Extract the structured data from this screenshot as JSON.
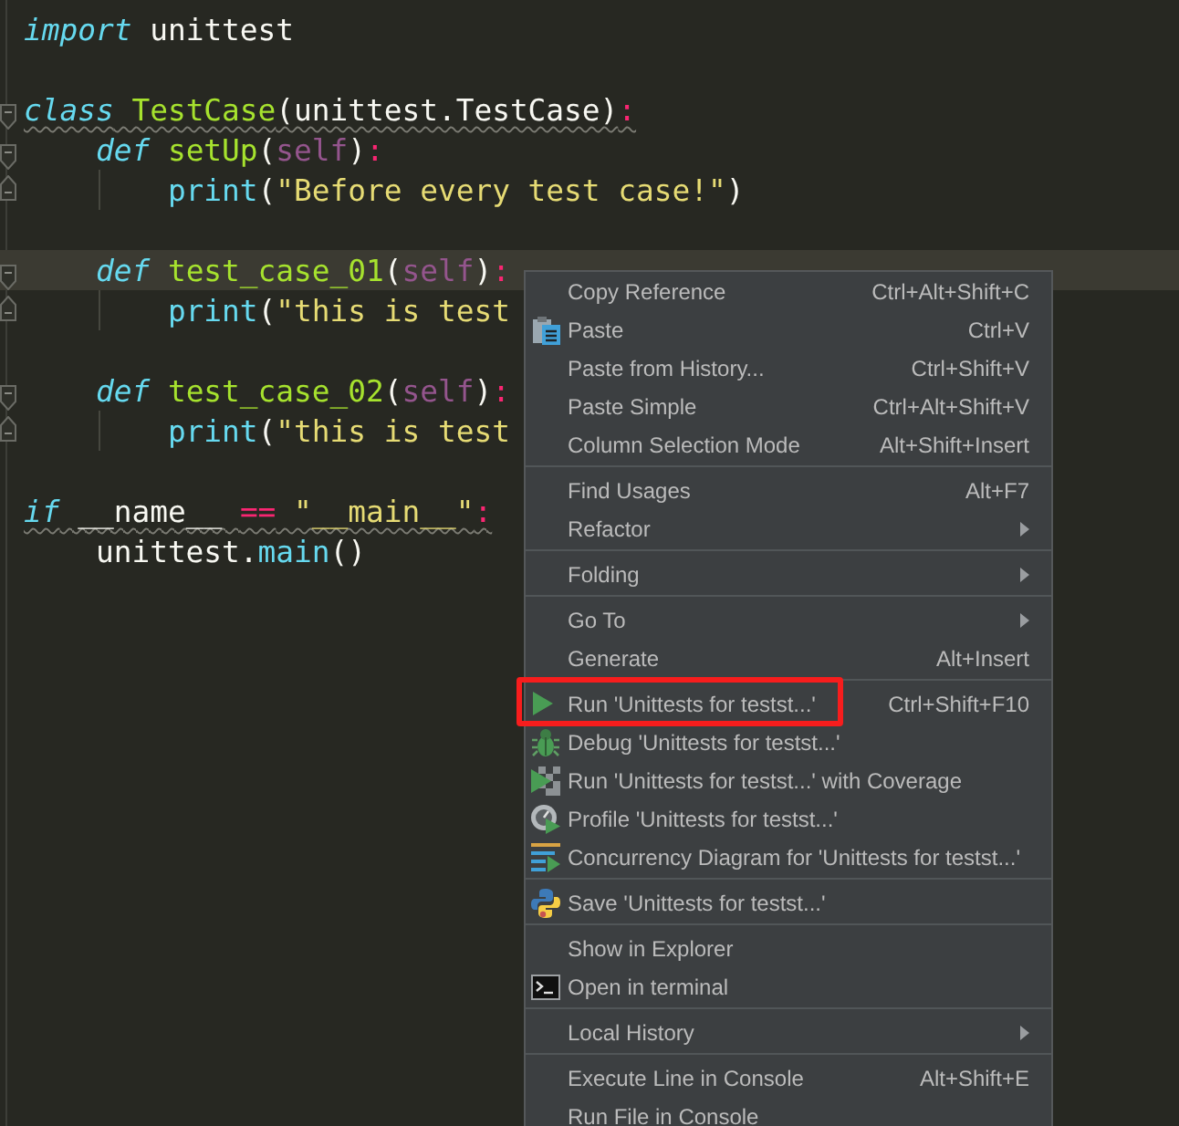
{
  "editor": {
    "lines": [
      {
        "kind": "code",
        "current": false,
        "warning": false,
        "fold_start": false,
        "fold_end": false,
        "tokens": [
          {
            "text": "import",
            "kind": "keyword"
          },
          {
            "text": " unittest",
            "kind": "plain"
          }
        ]
      },
      {
        "kind": "blank"
      },
      {
        "kind": "code",
        "current": false,
        "warning": true,
        "fold_start": true,
        "fold_end": false,
        "tokens": [
          {
            "text": "class",
            "kind": "keyword"
          },
          {
            "text": " TestCase",
            "kind": "name"
          },
          {
            "text": "(unittest.TestCase)",
            "kind": "plain"
          },
          {
            "text": ":",
            "kind": "punct"
          }
        ],
        "children": [
          {
            "kind": "code",
            "current": false,
            "warning": false,
            "fold_start": true,
            "fold_end": false,
            "tokens": [
              {
                "text": "def",
                "kind": "keyword"
              },
              {
                "text": " setUp",
                "kind": "name"
              },
              {
                "text": "(",
                "kind": "plain"
              },
              {
                "text": "self",
                "kind": "self"
              },
              {
                "text": ")",
                "kind": "plain"
              },
              {
                "text": ":",
                "kind": "punct"
              }
            ],
            "children": [
              {
                "kind": "code",
                "current": false,
                "warning": false,
                "fold_start": false,
                "fold_end": true,
                "tokens": [
                  {
                    "text": "print",
                    "kind": "builtin"
                  },
                  {
                    "text": "(",
                    "kind": "plain"
                  },
                  {
                    "text": "\"Before every test case!\"",
                    "kind": "string"
                  },
                  {
                    "text": ")",
                    "kind": "plain"
                  }
                ]
              }
            ]
          },
          {
            "kind": "blank"
          },
          {
            "kind": "code",
            "current": true,
            "warning": false,
            "fold_start": true,
            "fold_end": false,
            "tokens": [
              {
                "text": "def",
                "kind": "keyword"
              },
              {
                "text": " test_case_01",
                "kind": "name"
              },
              {
                "text": "(",
                "kind": "plain"
              },
              {
                "text": "self",
                "kind": "self"
              },
              {
                "text": ")",
                "kind": "plain"
              },
              {
                "text": ":",
                "kind": "punct"
              }
            ],
            "children": [
              {
                "kind": "code",
                "current": false,
                "warning": false,
                "fold_start": false,
                "fold_end": true,
                "tokens": [
                  {
                    "text": "print",
                    "kind": "builtin"
                  },
                  {
                    "text": "(",
                    "kind": "plain"
                  },
                  {
                    "text": "\"this is test",
                    "kind": "string"
                  }
                ]
              }
            ]
          },
          {
            "kind": "blank"
          },
          {
            "kind": "code",
            "current": false,
            "warning": false,
            "fold_start": true,
            "fold_end": false,
            "tokens": [
              {
                "text": "def",
                "kind": "keyword"
              },
              {
                "text": " test_case_02",
                "kind": "name"
              },
              {
                "text": "(",
                "kind": "plain"
              },
              {
                "text": "self",
                "kind": "self"
              },
              {
                "text": ")",
                "kind": "plain"
              },
              {
                "text": ":",
                "kind": "punct"
              }
            ],
            "children": [
              {
                "kind": "code",
                "current": false,
                "warning": false,
                "fold_start": false,
                "fold_end": true,
                "tokens": [
                  {
                    "text": "print",
                    "kind": "builtin"
                  },
                  {
                    "text": "(",
                    "kind": "plain"
                  },
                  {
                    "text": "\"this is test",
                    "kind": "string"
                  }
                ]
              }
            ]
          }
        ]
      },
      {
        "kind": "blank"
      },
      {
        "kind": "code",
        "current": false,
        "warning": true,
        "fold_start": false,
        "fold_end": false,
        "tokens": [
          {
            "text": "if",
            "kind": "keyword"
          },
          {
            "text": " __name__ ",
            "kind": "plain"
          },
          {
            "text": "==",
            "kind": "punct"
          },
          {
            "text": " \"__main__\"",
            "kind": "string"
          },
          {
            "text": ":",
            "kind": "punct"
          }
        ],
        "children": [
          {
            "kind": "code",
            "current": false,
            "warning": false,
            "fold_start": false,
            "fold_end": false,
            "tokens": [
              {
                "text": "unittest.",
                "kind": "plain"
              },
              {
                "text": "main",
                "kind": "builtin"
              },
              {
                "text": "()",
                "kind": "plain"
              }
            ]
          }
        ]
      }
    ]
  },
  "menu": {
    "groups": [
      [
        {
          "label": "Copy Reference",
          "shortcut": "Ctrl+Alt+Shift+C",
          "kind": "plain",
          "submenu": false,
          "annotated": false
        },
        {
          "label": "Paste",
          "shortcut": "Ctrl+V",
          "kind": "paste",
          "submenu": false,
          "annotated": false
        },
        {
          "label": "Paste from History...",
          "shortcut": "Ctrl+Shift+V",
          "kind": "plain",
          "submenu": false,
          "annotated": false
        },
        {
          "label": "Paste Simple",
          "shortcut": "Ctrl+Alt+Shift+V",
          "kind": "plain",
          "submenu": false,
          "annotated": false
        },
        {
          "label": "Column Selection Mode",
          "shortcut": "Alt+Shift+Insert",
          "kind": "plain",
          "submenu": false,
          "annotated": false
        }
      ],
      [
        {
          "label": "Find Usages",
          "shortcut": "Alt+F7",
          "kind": "plain",
          "submenu": false,
          "annotated": false
        },
        {
          "label": "Refactor",
          "kind": "plain",
          "submenu": true,
          "annotated": false
        }
      ],
      [
        {
          "label": "Folding",
          "kind": "plain",
          "submenu": true,
          "annotated": false
        }
      ],
      [
        {
          "label": "Go To",
          "kind": "plain",
          "submenu": true,
          "annotated": false
        },
        {
          "label": "Generate",
          "shortcut": "Alt+Insert",
          "kind": "plain",
          "submenu": false,
          "annotated": false
        }
      ],
      [
        {
          "label": "Run 'Unittests for testst...'",
          "shortcut": "Ctrl+Shift+F10",
          "kind": "run",
          "submenu": false,
          "annotated": true
        },
        {
          "label": "Debug 'Unittests for testst...'",
          "kind": "debug",
          "submenu": false,
          "annotated": false
        },
        {
          "label": "Run 'Unittests for testst...' with Coverage",
          "kind": "coverage",
          "submenu": false,
          "annotated": false
        },
        {
          "label": "Profile 'Unittests for testst...'",
          "kind": "profile",
          "submenu": false,
          "annotated": false
        },
        {
          "label": "Concurrency Diagram for 'Unittests for testst...'",
          "kind": "concurrency",
          "submenu": false,
          "annotated": false
        }
      ],
      [
        {
          "label": "Save 'Unittests for testst...'",
          "kind": "save",
          "submenu": false,
          "annotated": false
        }
      ],
      [
        {
          "label": "Show in Explorer",
          "kind": "plain",
          "submenu": false,
          "annotated": false
        },
        {
          "label": "Open in terminal",
          "kind": "terminal",
          "submenu": false,
          "annotated": false
        }
      ],
      [
        {
          "label": "Local History",
          "kind": "plain",
          "submenu": true,
          "annotated": false
        }
      ],
      [
        {
          "label": "Execute Line in Console",
          "shortcut": "Alt+Shift+E",
          "kind": "plain",
          "submenu": false,
          "annotated": false
        },
        {
          "label": "Run File in Console",
          "kind": "plain",
          "submenu": false,
          "annotated": false
        }
      ]
    ]
  }
}
